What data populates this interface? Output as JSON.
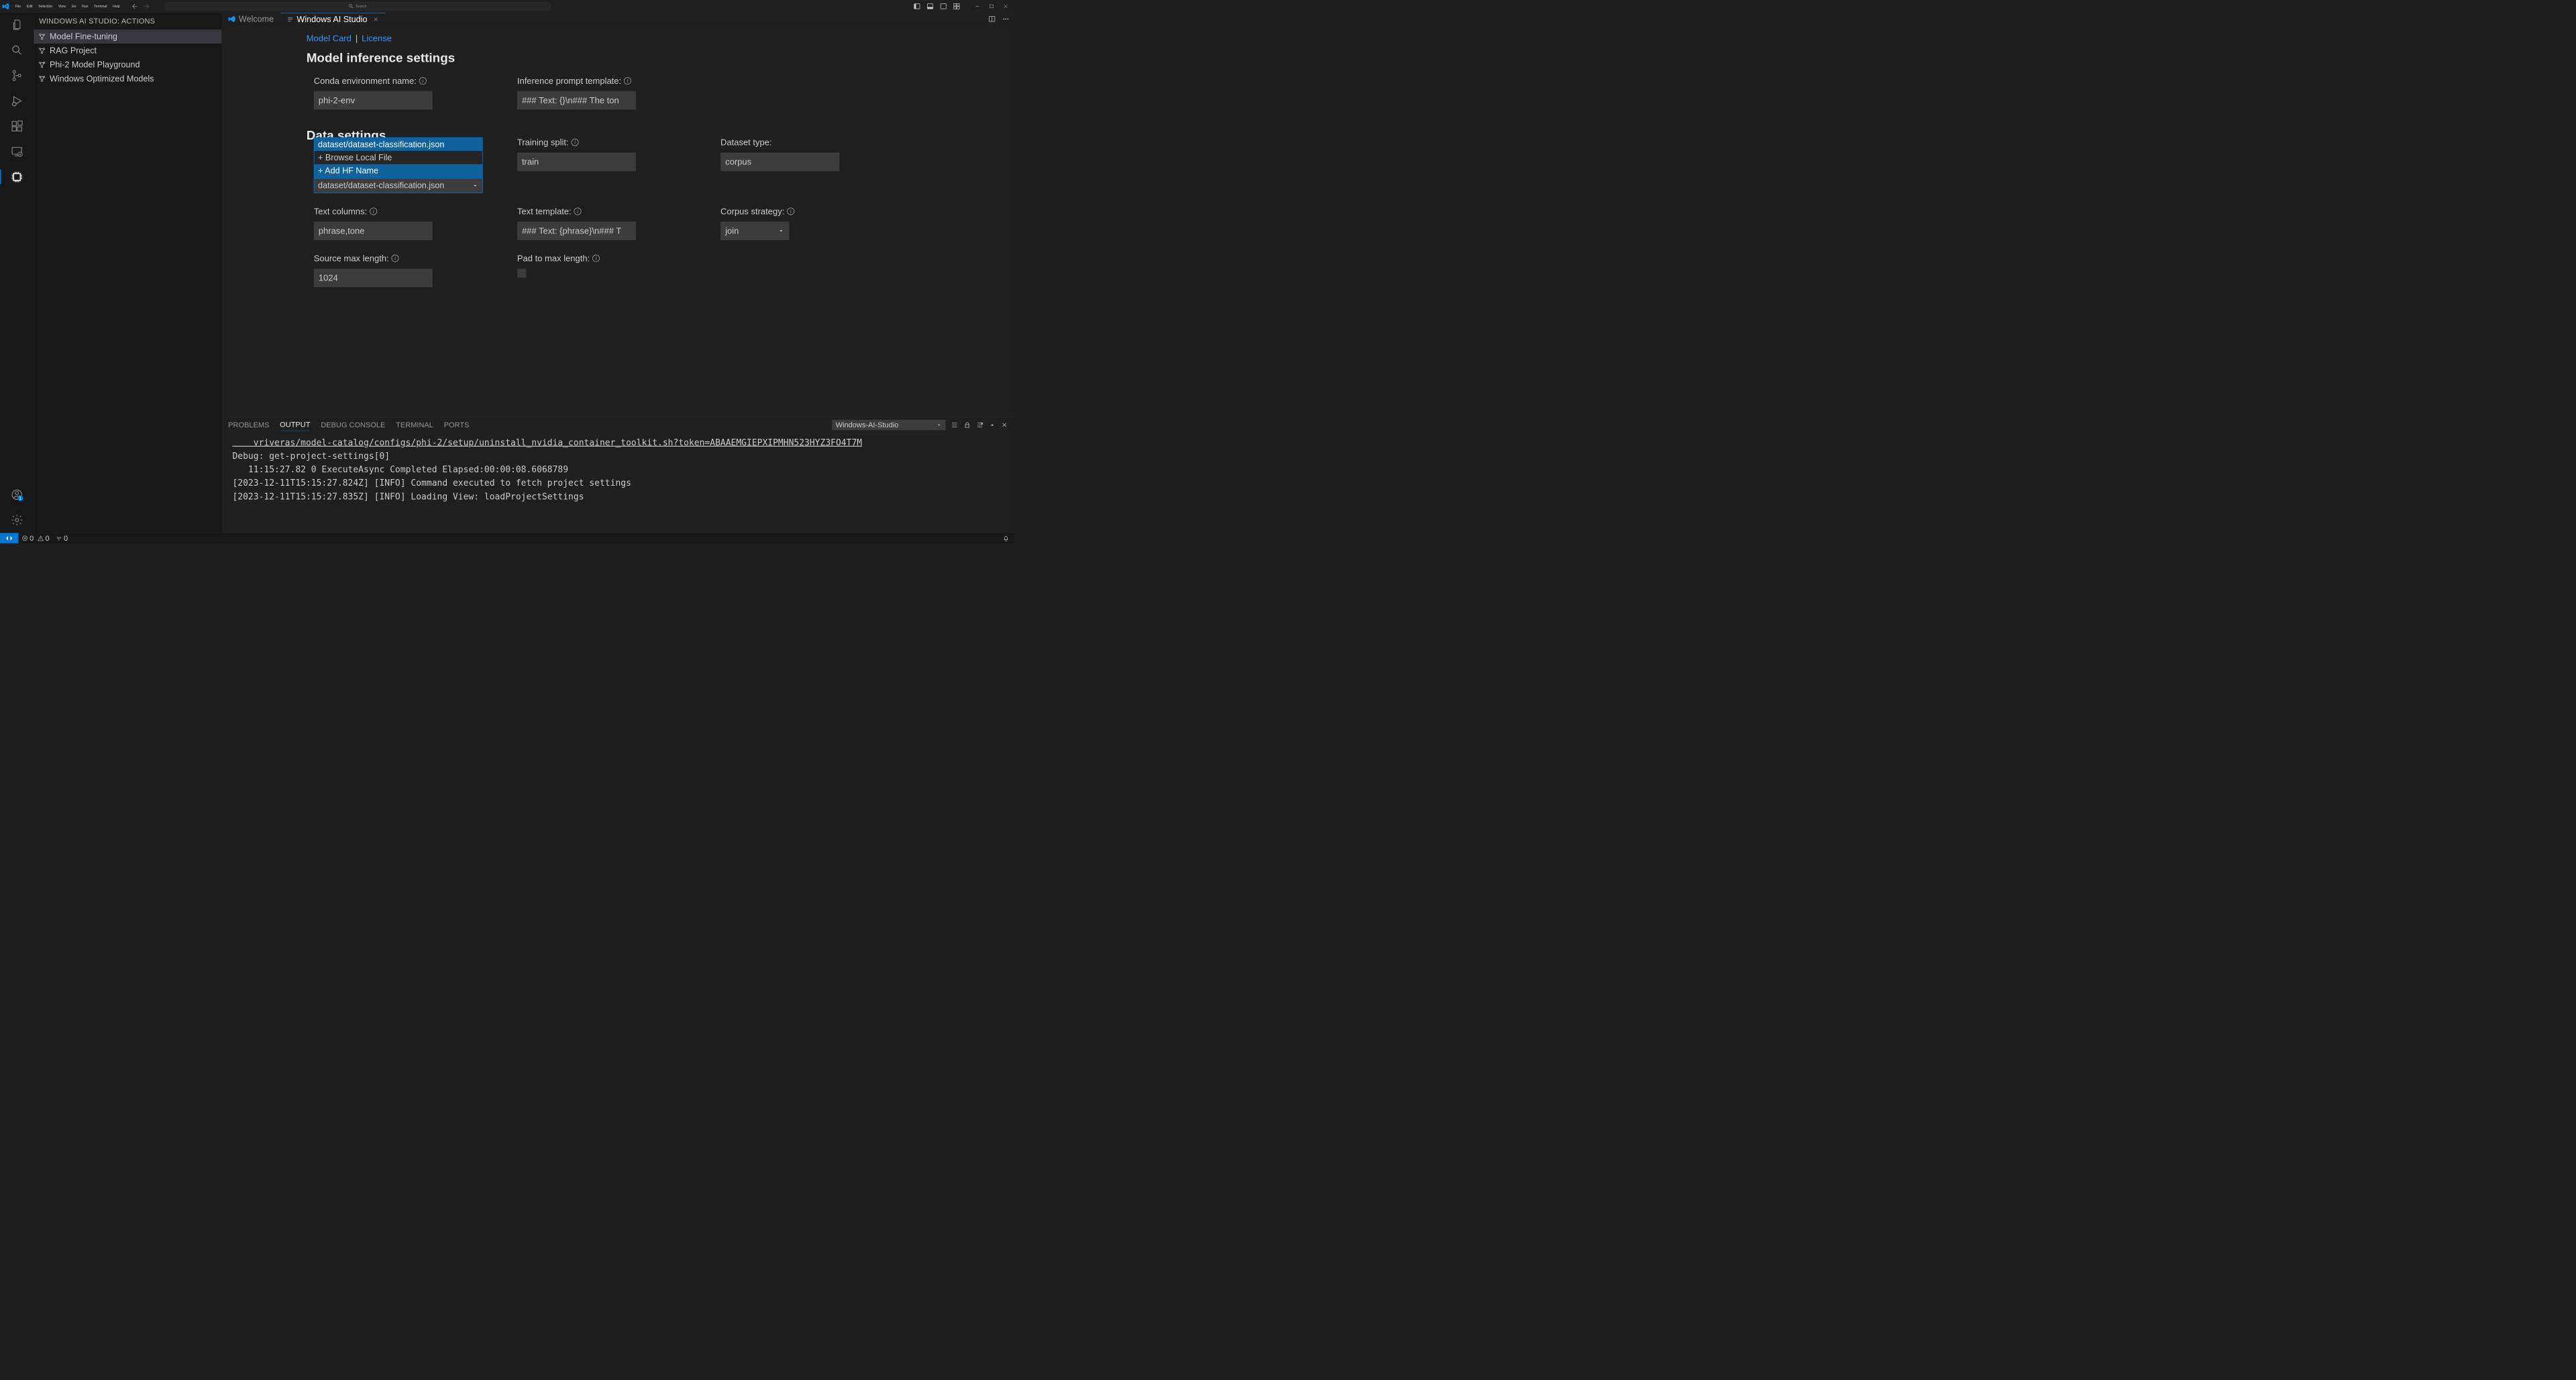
{
  "menubar": {
    "items": [
      "File",
      "Edit",
      "Selection",
      "View",
      "Go",
      "Run",
      "Terminal",
      "Help"
    ],
    "search_placeholder": "Search"
  },
  "sidebar": {
    "title": "WINDOWS AI STUDIO: ACTIONS",
    "items": [
      {
        "label": "Model Fine-tuning",
        "selected": true
      },
      {
        "label": "RAG Project",
        "selected": false
      },
      {
        "label": "Phi-2 Model Playground",
        "selected": false
      },
      {
        "label": "Windows Optimized Models",
        "selected": false
      }
    ]
  },
  "tabs": {
    "welcome": "Welcome",
    "main": "Windows AI Studio"
  },
  "content": {
    "model_card": "Model Card",
    "license": "License",
    "inference_heading": "Model inference settings",
    "conda_env_label": "Conda environment name:",
    "conda_env_value": "phi-2-env",
    "inference_prompt_label": "Inference prompt template:",
    "inference_prompt_value": "### Text: {}\\n### The ton",
    "data_heading": "Data settings",
    "dataset_options": {
      "opt1": "dataset/dataset-classification.json",
      "opt2": "+ Browse Local File",
      "opt3": "+ Add HF Name",
      "current": "dataset/dataset-classification.json"
    },
    "training_split_label": "Training split:",
    "training_split_value": "train",
    "dataset_type_label": "Dataset type:",
    "dataset_type_value": "corpus",
    "text_columns_label": "Text columns:",
    "text_columns_value": "phrase,tone",
    "text_template_label": "Text template:",
    "text_template_value": "### Text: {phrase}\\n### T",
    "corpus_strategy_label": "Corpus strategy:",
    "corpus_strategy_value": "join",
    "source_max_length_label": "Source max length:",
    "source_max_length_value": "1024",
    "pad_max_length_label": "Pad to max length:"
  },
  "panel": {
    "tabs": {
      "problems": "PROBLEMS",
      "output": "OUTPUT",
      "debug": "DEBUG CONSOLE",
      "terminal": "TERMINAL",
      "ports": "PORTS"
    },
    "output_selector": "Windows-AI-Studio",
    "output_lines": {
      "l1": "    vriveras/model-catalog/configs/phi-2/setup/uninstall_nvidia_container_toolkit.sh?token=ABAAEMGIEPXIPMHN523HYZ3FO4T7M",
      "l2": "Debug: get-project-settings[0]",
      "l3": "   11:15:27.82 0 ExecuteAsync Completed Elapsed:00:00:08.6068789",
      "l4": "[2023-12-11T15:15:27.824Z] [INFO] Command executed to fetch project settings",
      "l5": "[2023-12-11T15:15:27.835Z] [INFO] Loading View: loadProjectSettings"
    }
  },
  "statusbar": {
    "errors": "0",
    "warnings": "0",
    "ports": "0"
  }
}
